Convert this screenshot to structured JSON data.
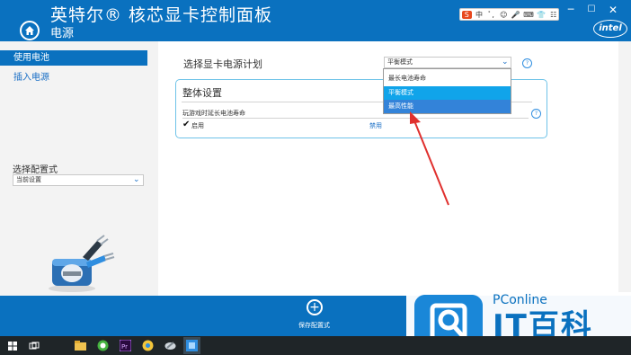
{
  "window": {
    "app_title": "英特尔® 核芯显卡控制面板",
    "section": "电源",
    "brand_logo": "intel"
  },
  "ime_bar": [
    "S",
    "中",
    "ﾟ,",
    "☺",
    "🎤",
    "⌨",
    "👕",
    "☷"
  ],
  "sidebar": {
    "items": [
      {
        "label": "使用电池",
        "active": true
      },
      {
        "label": "插入电源",
        "active": false
      }
    ],
    "profile_label": "选择配置式",
    "profile_value": "当前设置"
  },
  "main": {
    "plan_label": "选择显卡电源计划",
    "plan_value": "平衡模式",
    "plan_options": [
      "最长电池寿命",
      "平衡模式",
      "最高性能"
    ],
    "overall_title": "整体设置",
    "setting_label": "玩游戏时延长电池寿命",
    "enable_label": "启用",
    "disable_label": "禁用"
  },
  "bottom": {
    "save_label": "保存配置式"
  },
  "watermark": {
    "top": "PConline",
    "bottom": "IT百科"
  },
  "colors": {
    "header_blue": "#0a71bf",
    "highlight_cyan": "#10a4ea",
    "highlight_blue": "#3383d9",
    "arrow_red": "#e0302e"
  }
}
